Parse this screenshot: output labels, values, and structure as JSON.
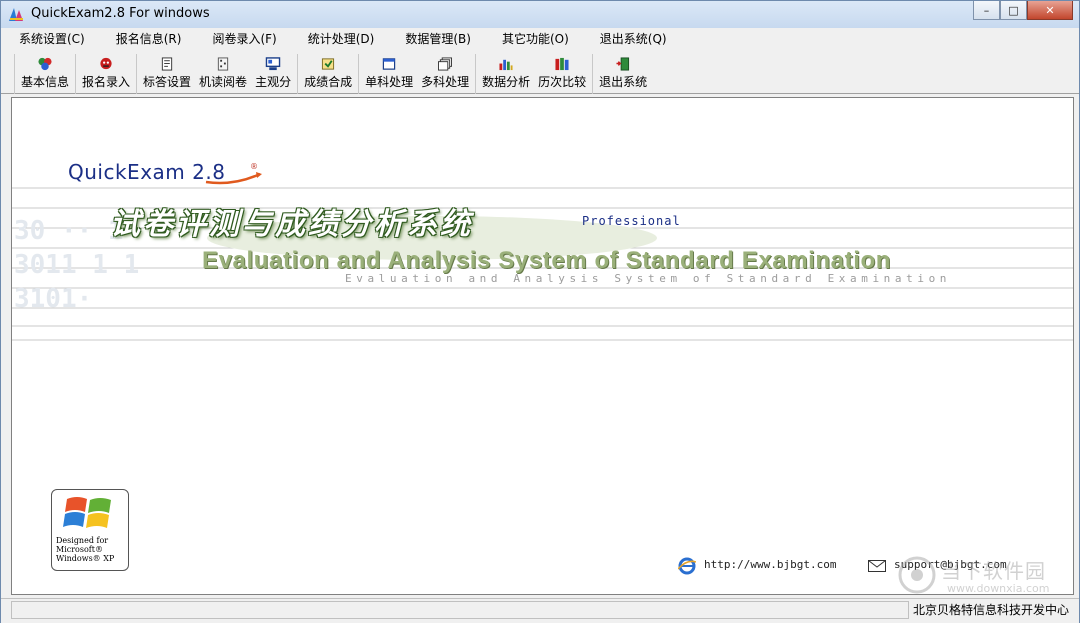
{
  "window": {
    "title": "QuickExam2.8  For windows",
    "controls": {
      "minimize": "–",
      "maximize": "□",
      "close": "✕"
    }
  },
  "menubar": {
    "items": [
      {
        "label": "系统设置(C)"
      },
      {
        "label": "报名信息(R)"
      },
      {
        "label": "阅卷录入(F)"
      },
      {
        "label": "统计处理(D)"
      },
      {
        "label": "数据管理(B)"
      },
      {
        "label": "其它功能(O)"
      },
      {
        "label": "退出系统(Q)"
      }
    ]
  },
  "toolbar": {
    "buttons": [
      {
        "label": "基本信息",
        "icon": "basic-info-icon"
      },
      {
        "label": "报名录入",
        "icon": "registration-icon"
      },
      {
        "label": "标答设置",
        "icon": "answer-key-icon"
      },
      {
        "label": "机读阅卷",
        "icon": "machine-grading-icon"
      },
      {
        "label": "主观分",
        "icon": "subjective-score-icon"
      },
      {
        "label": "成绩合成",
        "icon": "score-merge-icon"
      },
      {
        "label": "单科处理",
        "icon": "single-subject-icon"
      },
      {
        "label": "多科处理",
        "icon": "multi-subject-icon"
      },
      {
        "label": "数据分析",
        "icon": "bar-chart-icon"
      },
      {
        "label": "历次比较",
        "icon": "books-compare-icon"
      },
      {
        "label": "退出系统",
        "icon": "exit-door-icon"
      }
    ]
  },
  "splash": {
    "brand": "QuickExam 2.8",
    "registered": "®",
    "cn_title": "试卷评测与成绩分析系统",
    "edition": "Professional",
    "en_title": "Evaluation and Analysis System of Standard Examination",
    "en_subtitle": "Evaluation and Analysis System of Standard Examination",
    "xp_badge": {
      "line1": "Designed for",
      "line2": "Microsoft®",
      "line3": "Windows® XP"
    },
    "website": "http://www.bjbgt.com",
    "email": "support@bjbgt.com"
  },
  "watermark": {
    "name": "当下软件园",
    "url": "www.downxia.com"
  },
  "statusbar": {
    "left": "",
    "right": "北京贝格特信息科技开发中心"
  },
  "colors": {
    "brand_blue": "#1b2f86",
    "title_green": "#2f5a1f",
    "en_green": "#9ab07a"
  }
}
